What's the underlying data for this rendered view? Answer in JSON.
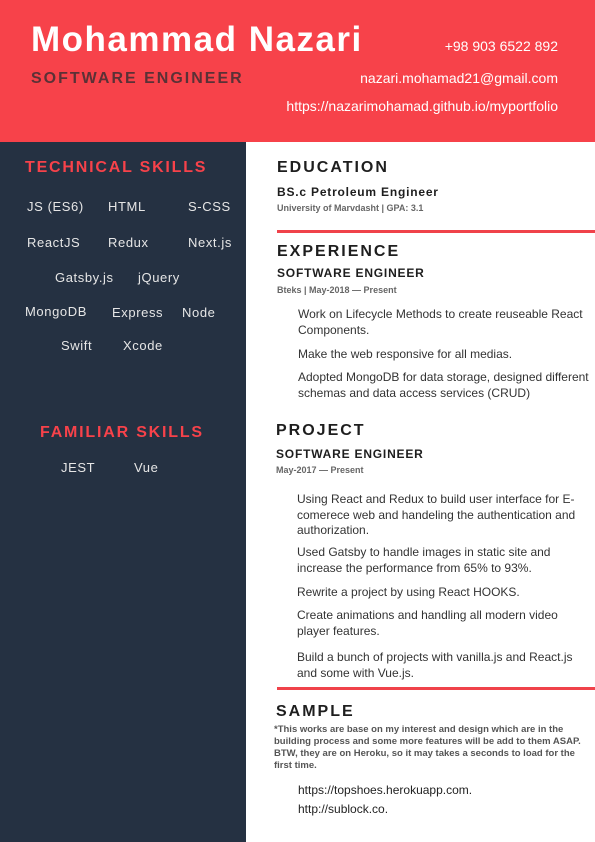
{
  "header": {
    "name": "Mohammad Nazari",
    "title": "SOFTWARE ENGINEER",
    "phone": "+98 903 6522 892",
    "email": "nazari.mohamad21@gmail.com",
    "website": "https://nazarimohamad.github.io/myportfolio"
  },
  "sidebar": {
    "technical_title": "TECHNICAL SKILLS",
    "technical_skills": [
      "JS (ES6)",
      "HTML",
      "S-CSS",
      "ReactJS",
      "Redux",
      "Next.js",
      "Gatsby.js",
      "jQuery",
      "MongoDB",
      "Express",
      "Node",
      "Swift",
      "Xcode"
    ],
    "familiar_title": "FAMILIAR SKILLS",
    "familiar_skills": [
      "JEST",
      "Vue"
    ]
  },
  "education": {
    "title": "EDUCATION",
    "degree": "BS.c Petroleum Engineer",
    "school": "University of Marvdasht | GPA: 3.1"
  },
  "experience": {
    "title": "EXPERIENCE",
    "job_title": "SOFTWARE ENGINEER",
    "meta": "Bteks | May-2018 — Present",
    "bullets": [
      "Work on Lifecycle Methods to create reuseable React Components.",
      "Make the web responsive for all medias.",
      "Adopted MongoDB for data storage, designed different schemas and data access services (CRUD)"
    ]
  },
  "project": {
    "title": "PROJECT",
    "job_title": "SOFTWARE ENGINEER",
    "meta": "May-2017 — Present",
    "bullets": [
      "Using React and Redux to build user interface for E-comerece web and handeling the authentication and authorization.",
      "Used Gatsby to handle images in static site and increase the performance from 65% to 93%.",
      "Rewrite a project by using React HOOKS.",
      "Create animations and handling all modern video player features.",
      "Build a bunch of projects with vanilla.js and React.js and some with Vue.js."
    ]
  },
  "sample": {
    "title": "SAMPLE",
    "note": "*This works are base on my interest and design which are in the building process and some more features will be add to them ASAP. BTW, they are on Heroku, so it may takes a seconds to load for the first time.",
    "links": [
      "https://topshoes.herokuapp.com.",
      "http://sublock.co."
    ]
  },
  "colors": {
    "accent": "#f7424a",
    "sidebar": "#253142",
    "title_text": "#5b3136"
  }
}
